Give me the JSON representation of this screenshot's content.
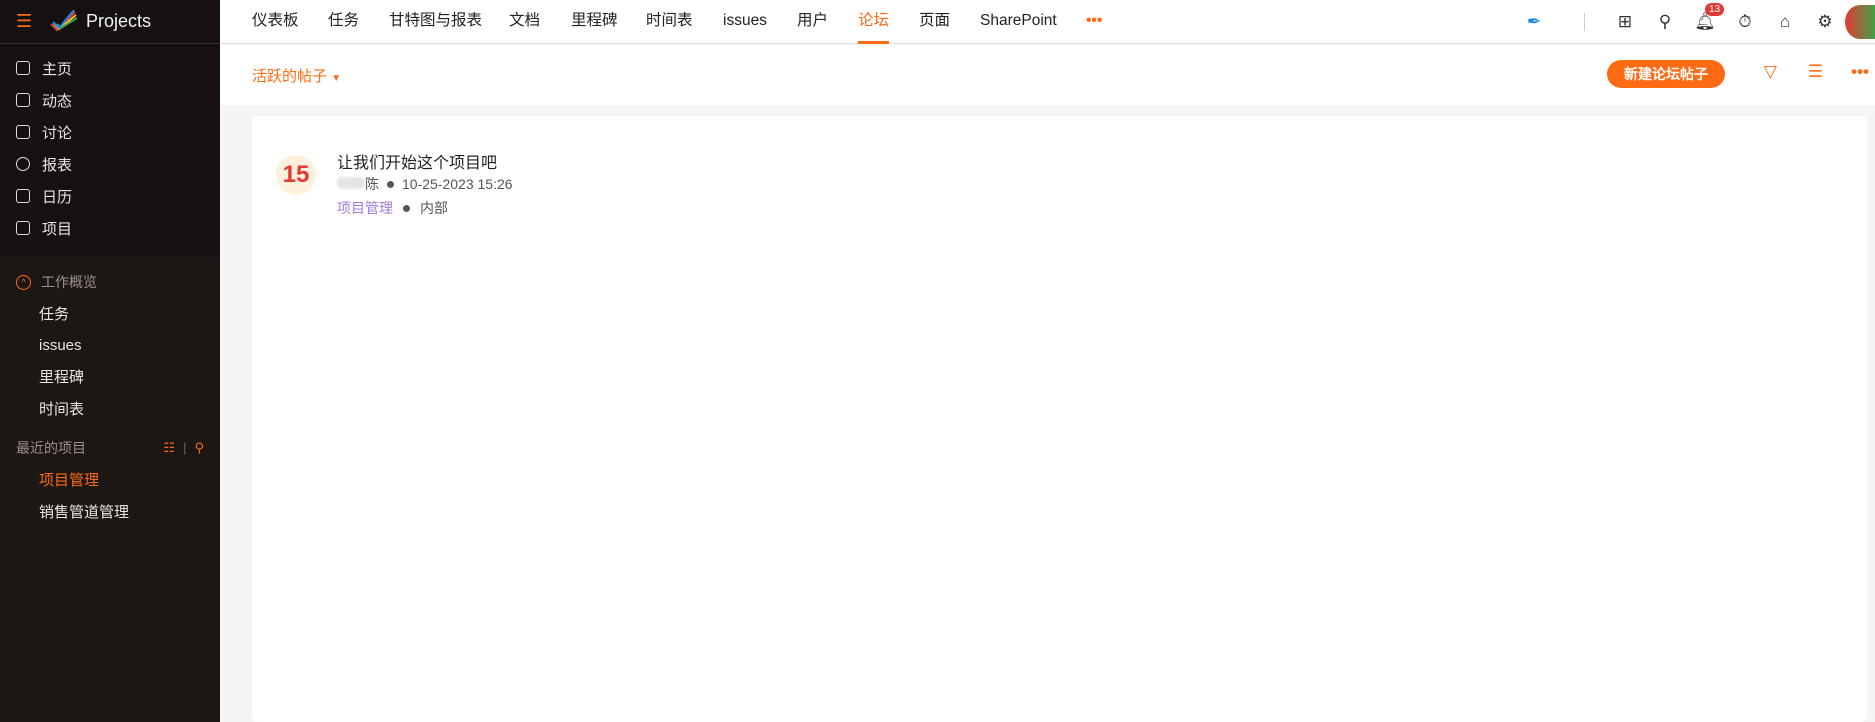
{
  "app": {
    "title": "Projects"
  },
  "sidebar": {
    "items": [
      {
        "label": "主页",
        "icon": "home-icon"
      },
      {
        "label": "动态",
        "icon": "feed-icon"
      },
      {
        "label": "讨论",
        "icon": "discussion-icon"
      },
      {
        "label": "报表",
        "icon": "reports-icon"
      },
      {
        "label": "日历",
        "icon": "calendar-icon"
      },
      {
        "label": "项目",
        "icon": "briefcase-icon"
      }
    ],
    "work_overview": {
      "label": "工作概览",
      "items": [
        "任务",
        "issues",
        "里程碑",
        "时间表"
      ]
    },
    "recent": {
      "label": "最近的项目",
      "items": [
        "项目管理",
        "销售管道管理"
      ]
    }
  },
  "tabs": [
    "仪表板",
    "任务",
    "甘特图与报表",
    "文档",
    "里程碑",
    "时间表",
    "issues",
    "用户",
    "论坛",
    "页面",
    "SharePoint"
  ],
  "active_tab": "论坛",
  "notifications": "13",
  "subbar": {
    "filter": "活跃的帖子",
    "new_button": "新建论坛帖子"
  },
  "post": {
    "avatar_text": "15",
    "title": "让我们开始这个项目吧",
    "author": "陈",
    "datetime": "10-25-2023 15:26",
    "project": "项目管理",
    "visibility": "内部"
  },
  "colors": {
    "accent": "#ff6a13",
    "sidebar": "#1c1614"
  }
}
